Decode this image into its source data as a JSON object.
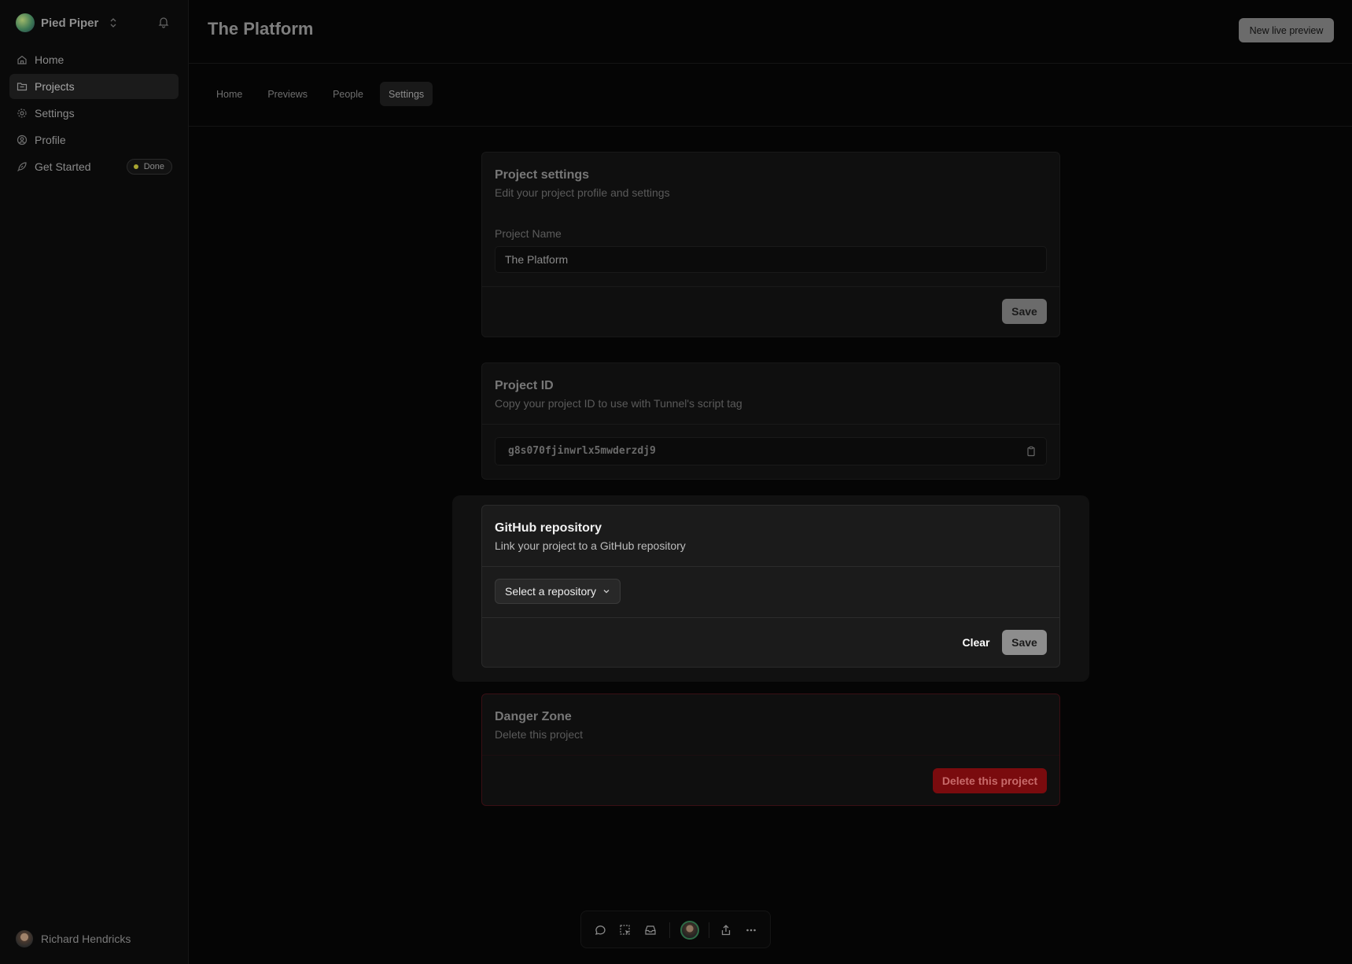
{
  "sidebar": {
    "org_name": "Pied Piper",
    "items": [
      {
        "label": "Home",
        "icon": "home-icon"
      },
      {
        "label": "Projects",
        "icon": "folder-icon",
        "active": true
      },
      {
        "label": "Settings",
        "icon": "gear-icon"
      },
      {
        "label": "Profile",
        "icon": "user-circle-icon"
      },
      {
        "label": "Get Started",
        "icon": "rocket-icon",
        "badge": "Done",
        "badge_color": "#a8a531"
      }
    ],
    "user_name": "Richard Hendricks"
  },
  "header": {
    "title": "The Platform",
    "new_preview_label": "New live preview"
  },
  "tabs": [
    {
      "label": "Home"
    },
    {
      "label": "Previews"
    },
    {
      "label": "People"
    },
    {
      "label": "Settings",
      "active": true
    }
  ],
  "project_settings": {
    "title": "Project settings",
    "subtitle": "Edit your project profile and settings",
    "name_label": "Project Name",
    "name_value": "The Platform",
    "save_label": "Save"
  },
  "project_id": {
    "title": "Project ID",
    "subtitle": "Copy your project ID to use with Tunnel's script tag",
    "value": "g8s070fjinwrlx5mwderzdj9"
  },
  "github": {
    "title": "GitHub repository",
    "subtitle": "Link your project to a GitHub repository",
    "select_label": "Select a repository",
    "clear_label": "Clear",
    "save_label": "Save"
  },
  "danger": {
    "title": "Danger Zone",
    "subtitle": "Delete this project",
    "delete_label": "Delete this project",
    "accent": "#7a0b0e"
  },
  "toolbar": {
    "icons": [
      "comment-icon",
      "select-area-icon",
      "inbox-icon",
      "avatar",
      "share-icon",
      "more-icon"
    ]
  }
}
